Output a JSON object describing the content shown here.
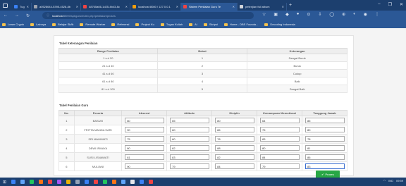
{
  "browser": {
    "tabs": [
      {
        "label": "Tugas",
        "color": "#3b82f6",
        "active": false
      },
      {
        "label": "a0528644-5395-4528-8b",
        "color": "#9ca3af",
        "active": false
      },
      {
        "label": "48765a66-1d25-4b43-8c",
        "color": "#ef4444",
        "active": false
      },
      {
        "label": "localhost:8080 / 127.0.0.1",
        "color": "#f59e0b",
        "active": false
      },
      {
        "label": "Sistem Penilaian Guru Te",
        "color": "#ef4444",
        "active": true
      },
      {
        "label": "petenjian full album",
        "color": "#d1d5db",
        "active": false
      }
    ],
    "new_tab": "+",
    "window_controls": [
      "–",
      "❐",
      "✕"
    ],
    "url_host": "localhost",
    "url_path": "/8000/spkguru/index.php/penilaian/proses",
    "bookmarks": [
      "Learn Crypto",
      "Lainnya",
      "Belajar Sk/lk",
      "Remote Worker",
      "Referensi",
      "Project Ku",
      "Tugas Kuliah",
      "AI",
      "Skripsi",
      "Home - DBS Founda...",
      "Decoding Indonesia"
    ]
  },
  "table1": {
    "title": "Tabel Keterangan Penilaian",
    "headers": [
      "Range Penilaian",
      "Bobot",
      "Keterangan"
    ],
    "rows": [
      [
        "1 s.d 20",
        "1",
        "Sangat Buruk"
      ],
      [
        "21 s.d 40",
        "2",
        "Buruk"
      ],
      [
        "41 s.d 60",
        "3",
        "Cukup"
      ],
      [
        "61 s.d 80",
        "4",
        "Baik"
      ],
      [
        "81 s.d 100",
        "5",
        "Sangat Baik"
      ]
    ]
  },
  "table2": {
    "title": "Tabel Penilaian Guru",
    "headers": [
      "No.",
      "Peserta",
      "Absensi",
      "Attitude",
      "Disiplin",
      "Kemampuan Memotivasi",
      "Tanggung Jawab"
    ],
    "rows": [
      {
        "no": "1",
        "name": "BASUKI",
        "values": [
          "80",
          "65",
          "80",
          "64",
          "85"
        ]
      },
      {
        "no": "2",
        "name": "FRITTA MANDA SARI",
        "values": [
          "90",
          "80",
          "86",
          "75",
          "80"
        ]
      },
      {
        "no": "3",
        "name": "SRI MAHIWATI",
        "values": [
          "75",
          "80",
          "78",
          "83",
          "78"
        ]
      },
      {
        "no": "4",
        "name": "DEWI IRMAYA",
        "values": [
          "80",
          "82",
          "88",
          "80",
          "81"
        ]
      },
      {
        "no": "5",
        "name": "SUSI LISNAWATI",
        "values": [
          "81",
          "83",
          "82",
          "84",
          "86"
        ]
      },
      {
        "no": "6",
        "name": "MULIANI",
        "values": [
          "90",
          "79",
          "84",
          "79",
          "83"
        ]
      }
    ]
  },
  "submit_label": "Proses",
  "taskbar": {
    "icon_colors": [
      "#3b82f6",
      "#60a5fa",
      "#22c55e",
      "#f97316",
      "#ef4444",
      "#a855f7",
      "#eab308",
      "#94a3b8",
      "#3b82f6",
      "#ef4444",
      "#22c55e",
      "#f97316",
      "#60a5fa",
      "#e5e7eb",
      "#3b82f6",
      "#ef4444"
    ],
    "tray": [
      "IND",
      "09:59"
    ]
  }
}
